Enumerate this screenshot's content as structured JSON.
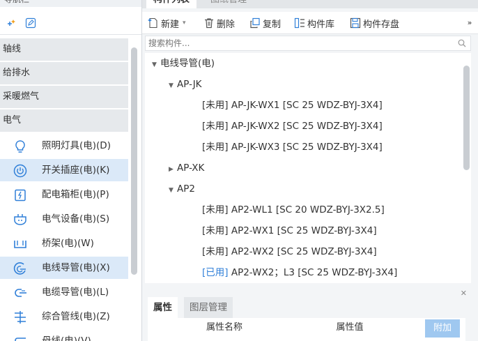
{
  "nav": {
    "header": "导航栏",
    "categories": [
      "轴线",
      "给排水",
      "采暖燃气",
      "电气"
    ],
    "items": [
      {
        "label": "照明灯具(电)(D)",
        "icon": "light-bulb-icon"
      },
      {
        "label": "开关插座(电)(K)",
        "icon": "power-socket-icon"
      },
      {
        "label": "配电箱柜(电)(P)",
        "icon": "distribution-box-icon"
      },
      {
        "label": "电气设备(电)(S)",
        "icon": "electrical-equipment-icon"
      },
      {
        "label": "桥架(电)(W)",
        "icon": "cable-tray-icon"
      },
      {
        "label": "电线导管(电)(X)",
        "icon": "wire-conduit-icon"
      },
      {
        "label": "电缆导管(电)(L)",
        "icon": "cable-conduit-icon"
      },
      {
        "label": "综合管线(电)(Z)",
        "icon": "integrated-pipeline-icon"
      },
      {
        "label": "母线(电)(V)",
        "icon": "busbar-icon"
      }
    ],
    "selected_index": 5
  },
  "tabs": [
    "构件列表",
    "图纸管理"
  ],
  "toolbar": {
    "new_label": "新建",
    "delete_label": "删除",
    "copy_label": "复制",
    "library_label": "构件库",
    "save_label": "构件存盘"
  },
  "search": {
    "placeholder": "搜索构件..."
  },
  "tree": {
    "root": "电线导管(电)",
    "groups": [
      {
        "name": "AP-JK",
        "expanded": true
      },
      {
        "name": "AP-XK",
        "expanded": false
      },
      {
        "name": "AP2",
        "expanded": true
      }
    ],
    "items": [
      {
        "status": "[未用]",
        "text": "AP-JK-WX1 [SC 25 WDZ-BYJ-3X4]"
      },
      {
        "status": "[未用]",
        "text": "AP-JK-WX2 [SC 25 WDZ-BYJ-3X4]"
      },
      {
        "status": "[未用]",
        "text": "AP-JK-WX3 [SC 25 WDZ-BYJ-3X4]"
      },
      {
        "status": "[未用]",
        "text": "AP2-WL1 [SC 20 WDZ-BYJ-3X2.5]"
      },
      {
        "status": "[未用]",
        "text": "AP2-WX1 [SC 25 WDZ-BYJ-3X4]"
      },
      {
        "status": "[未用]",
        "text": "AP2-WX2 [SC 25 WDZ-BYJ-3X4]"
      },
      {
        "status": "[已用]",
        "text": "AP2-WX2；L3 [SC 25 WDZ-BYJ-3X4]"
      }
    ]
  },
  "props": {
    "tabs": [
      "属性",
      "图层管理"
    ],
    "col_name": "属性名称",
    "col_value": "属性值",
    "add_label": "附加"
  },
  "colors": {
    "used": "#2f7fd8",
    "selected_bg": "#dbe9f8",
    "accent": "#9fc8f0"
  }
}
